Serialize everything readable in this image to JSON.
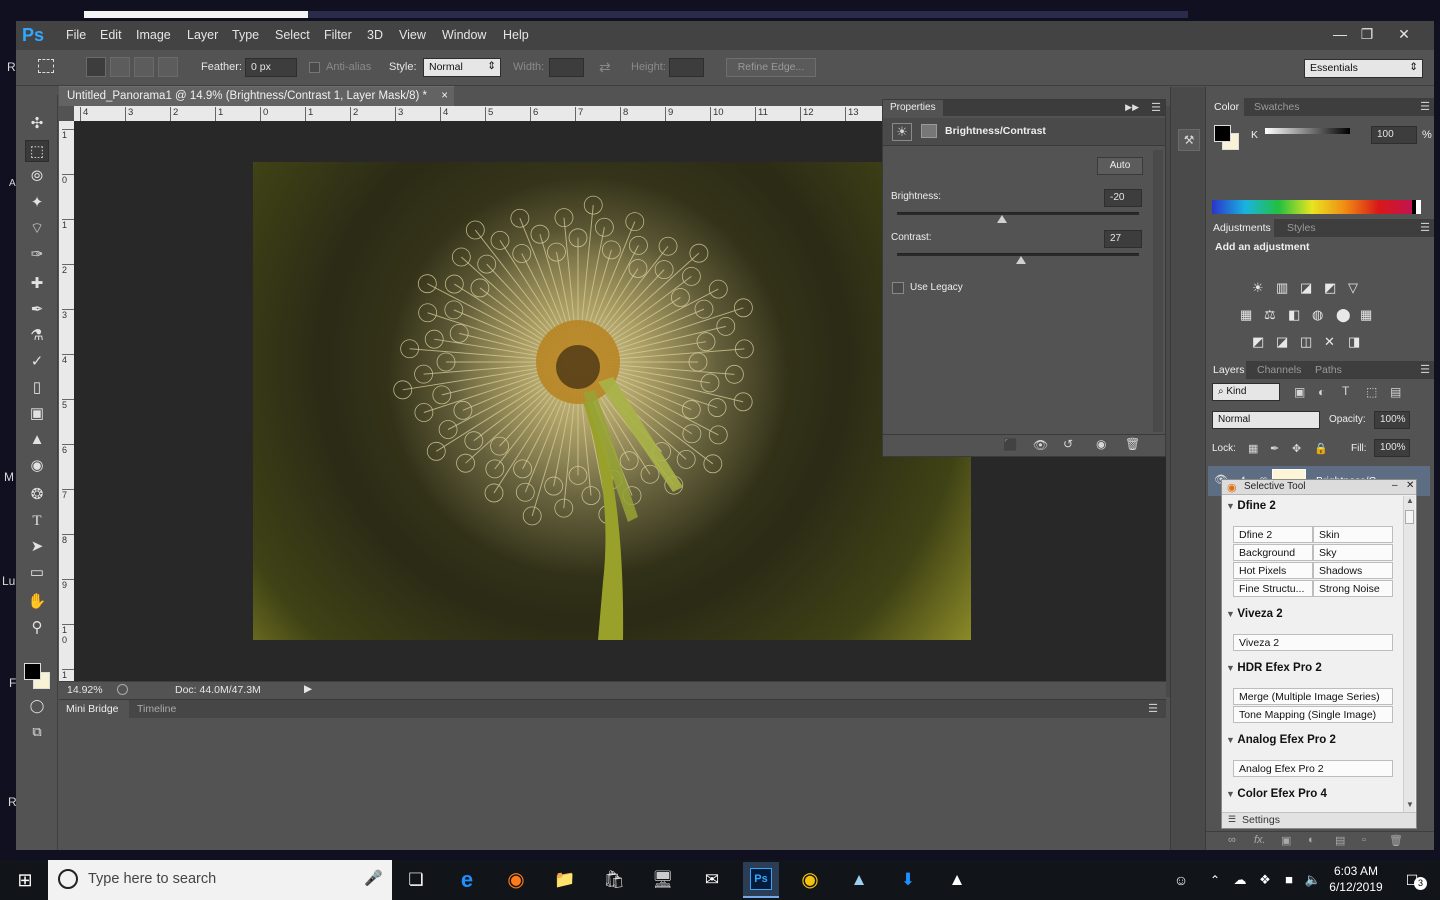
{
  "app": {
    "logo": "Ps",
    "menu": [
      "File",
      "Edit",
      "Image",
      "Layer",
      "Type",
      "Select",
      "Filter",
      "3D",
      "View",
      "Window",
      "Help"
    ]
  },
  "options": {
    "feather_label": "Feather:",
    "feather_value": "0 px",
    "antialias_label": "Anti-alias",
    "style_label": "Style:",
    "style_value": "Normal",
    "width_label": "Width:",
    "height_label": "Height:",
    "refine_edge": "Refine Edge...",
    "workspace": "Essentials"
  },
  "document": {
    "tab_title": "Untitled_Panorama1 @ 14.9% (Brightness/Contrast 1, Layer Mask/8) *",
    "zoom": "14.92%",
    "doc_info": "Doc: 44.0M/47.3M",
    "ruler_top": [
      "4",
      "3",
      "2",
      "1",
      "0",
      "1",
      "2",
      "3",
      "4",
      "5",
      "6",
      "7",
      "8",
      "9",
      "10",
      "11",
      "12",
      "13"
    ],
    "ruler_left": [
      "1",
      "0",
      "1",
      "2",
      "3",
      "4",
      "5",
      "6",
      "7",
      "8",
      "9",
      "1 0",
      "1 1"
    ]
  },
  "bridge": {
    "tabs": [
      "Mini Bridge",
      "Timeline"
    ]
  },
  "properties": {
    "title": "Properties",
    "subtitle": "Brightness/Contrast",
    "auto": "Auto",
    "brightness_label": "Brightness:",
    "brightness_value": "-20",
    "brightness": -20,
    "contrast_label": "Contrast:",
    "contrast_value": "27",
    "contrast": 27,
    "use_legacy": "Use Legacy"
  },
  "color_panel": {
    "tabs": [
      "Color",
      "Swatches"
    ],
    "channel": "K",
    "value": "100",
    "unit": "%"
  },
  "adjustments": {
    "tabs": [
      "Adjustments",
      "Styles"
    ],
    "heading": "Add an adjustment"
  },
  "layers": {
    "tabs": [
      "Layers",
      "Channels",
      "Paths"
    ],
    "kind": "Kind",
    "blend": "Normal",
    "opacity_label": "Opacity:",
    "opacity": "100%",
    "lock_label": "Lock:",
    "fill_label": "Fill:",
    "fill": "100%",
    "layer_name": "Brightness/C..."
  },
  "selective": {
    "title": "Selective Tool",
    "sections": [
      {
        "name": "Dfine 2",
        "items": [
          "Dfine 2",
          "Skin",
          "Background",
          "Sky",
          "Hot Pixels",
          "Shadows",
          "Fine Structu...",
          "Strong Noise"
        ]
      },
      {
        "name": "Viveza 2",
        "items": [
          "Viveza 2"
        ]
      },
      {
        "name": "HDR Efex Pro 2",
        "items": [
          "Merge (Multiple Image Series)",
          "Tone Mapping (Single Image)"
        ]
      },
      {
        "name": "Analog Efex Pro 2",
        "items": [
          "Analog Efex Pro 2"
        ]
      },
      {
        "name": "Color Efex Pro 4",
        "items": []
      }
    ],
    "settings": "Settings"
  },
  "taskbar": {
    "search_placeholder": "Type here to search",
    "time": "6:03 AM",
    "date": "6/12/2019",
    "notifications": "3"
  },
  "desktop_edge": [
    "R",
    "A",
    "M",
    "Lu",
    "F",
    "R"
  ]
}
